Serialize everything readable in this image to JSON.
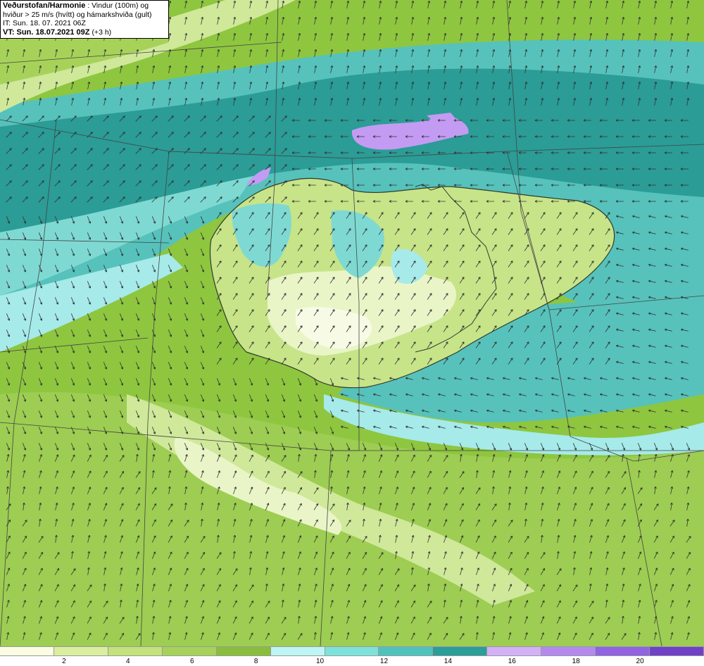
{
  "header": {
    "brand": "Veðurstofan/Harmonie",
    "description_line1": ": Vindur (100m) og",
    "description_line2": "hviður > 25 m/s (hvítt) og hámarkshviða (gult)",
    "init_time": "IT: Sun. 18. 07. 2021 06Z",
    "valid_time": "VT: Sun. 18.07.2021 09Z",
    "forecast_offset": "(+3 h)"
  },
  "legend": {
    "colors": [
      "#fbfde2",
      "#dbeea0",
      "#c4e27b",
      "#a7d25a",
      "#8bbd3d",
      "#bdf6f4",
      "#7ee2dc",
      "#4ec3bd",
      "#2a9e98",
      "#d3b0f7",
      "#b489ef",
      "#9162e2",
      "#7040c8"
    ],
    "ticks": [
      "2",
      "4",
      "6",
      "8",
      "10",
      "12",
      "14",
      "16",
      "18",
      "20"
    ]
  },
  "map_colors": {
    "land": "#c7e488",
    "land_light": "#f2f8d6",
    "sea_fast": "#2b9c96",
    "sea_mid": "#56c2bb",
    "sea_slow": "#a6eaea",
    "purple": "#c39bf3",
    "coast": "#2e3a2e",
    "grid": "#444444",
    "arrow": "#333333"
  }
}
